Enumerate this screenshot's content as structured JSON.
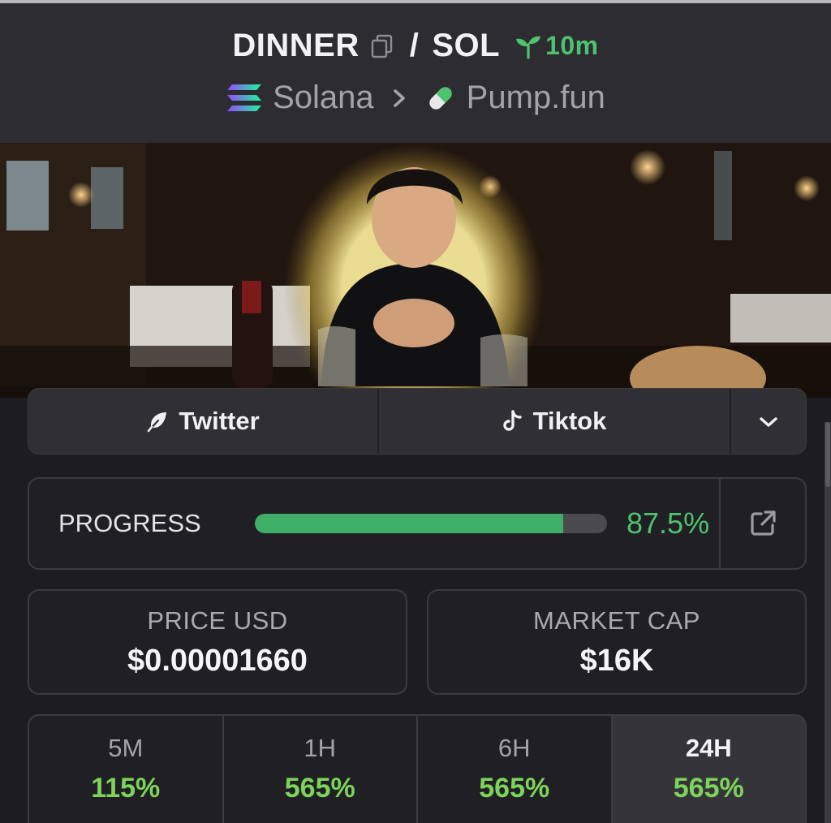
{
  "header": {
    "token_symbol": "DINNER",
    "separator": "/",
    "quote_symbol": "SOL",
    "age": "10m",
    "chain": "Solana",
    "platform": "Pump.fun",
    "accent_green": "#4fc26f"
  },
  "socials": {
    "twitter_label": "Twitter",
    "tiktok_label": "Tiktok"
  },
  "progress": {
    "label": "PROGRESS",
    "value_text": "87.5%",
    "value": 87.5
  },
  "stats": {
    "price_label": "PRICE USD",
    "price_value": "$0.00001660",
    "mcap_label": "MARKET CAP",
    "mcap_value": "$16K"
  },
  "periods": [
    {
      "label": "5M",
      "value": "115%",
      "active": false
    },
    {
      "label": "1H",
      "value": "565%",
      "active": false
    },
    {
      "label": "6H",
      "value": "565%",
      "active": false
    },
    {
      "label": "24H",
      "value": "565%",
      "active": true
    }
  ]
}
